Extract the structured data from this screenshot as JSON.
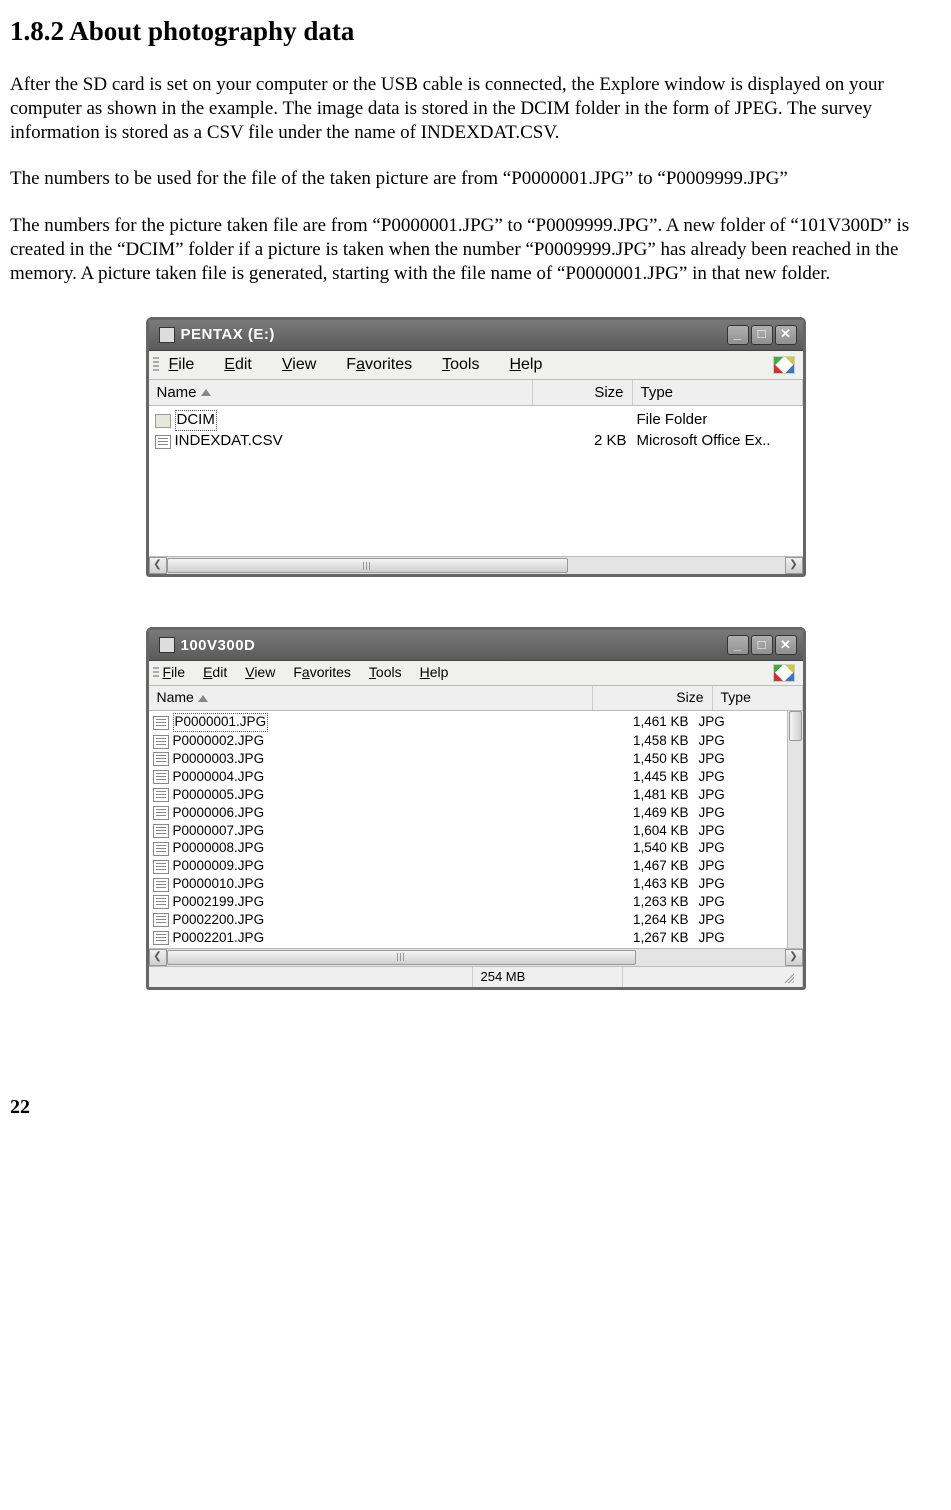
{
  "heading": "1.8.2 About photography data",
  "para1": "After the SD card is set on your computer or the USB cable is connected, the Explore window is displayed on your computer as shown in the example. The image data is stored in the DCIM folder in the form of JPEG. The survey information is stored as a CSV file under the name of INDEXDAT.CSV.",
  "para2": "The numbers to be used for the file of the taken  picture are from “P0000001.JPG” to “P0009999.JPG”",
  "para3": "The numbers for the picture taken file are from “P0000001.JPG” to “P0009999.JPG”. A new folder of “101V300D” is created in the “DCIM” folder if a picture is taken when the number “P0009999.JPG” has already been reached in the memory. A picture taken file is generated, starting with the file name of “P0000001.JPG” in that new folder.",
  "page_number": "22",
  "window1": {
    "title": "PENTAX (E:)",
    "menu": {
      "file": "File",
      "edit": "Edit",
      "view": "View",
      "favorites": "Favorites",
      "tools": "Tools",
      "help": "Help"
    },
    "cols": {
      "name": "Name",
      "size": "Size",
      "type": "Type"
    },
    "rows": [
      {
        "name": "DCIM",
        "size": "",
        "type": "File Folder",
        "icon": "folder",
        "selected": true
      },
      {
        "name": "INDEXDAT.CSV",
        "size": "2 KB",
        "type": "Microsoft Office Ex..",
        "icon": "csv",
        "selected": false
      }
    ]
  },
  "window2": {
    "title": "100V300D",
    "menu": {
      "file": "File",
      "edit": "Edit",
      "view": "View",
      "favorites": "Favorites",
      "tools": "Tools",
      "help": "Help"
    },
    "cols": {
      "name": "Name",
      "size": "Size",
      "type": "Type"
    },
    "rows": [
      {
        "name": "P0000001.JPG",
        "size": "1,461 KB",
        "type": "JPG",
        "selected": true
      },
      {
        "name": "P0000002.JPG",
        "size": "1,458 KB",
        "type": "JPG"
      },
      {
        "name": "P0000003.JPG",
        "size": "1,450 KB",
        "type": "JPG"
      },
      {
        "name": "P0000004.JPG",
        "size": "1,445 KB",
        "type": "JPG"
      },
      {
        "name": "P0000005.JPG",
        "size": "1,481 KB",
        "type": "JPG"
      },
      {
        "name": "P0000006.JPG",
        "size": "1,469 KB",
        "type": "JPG"
      },
      {
        "name": "P0000007.JPG",
        "size": "1,604 KB",
        "type": "JPG"
      },
      {
        "name": "P0000008.JPG",
        "size": "1,540 KB",
        "type": "JPG"
      },
      {
        "name": "P0000009.JPG",
        "size": "1,467 KB",
        "type": "JPG"
      },
      {
        "name": "P0000010.JPG",
        "size": "1,463 KB",
        "type": "JPG"
      },
      {
        "name": "P0002199.JPG",
        "size": "1,263 KB",
        "type": "JPG"
      },
      {
        "name": "P0002200.JPG",
        "size": "1,264 KB",
        "type": "JPG"
      },
      {
        "name": "P0002201.JPG",
        "size": "1,267 KB",
        "type": "JPG"
      }
    ],
    "status": "254 MB"
  }
}
